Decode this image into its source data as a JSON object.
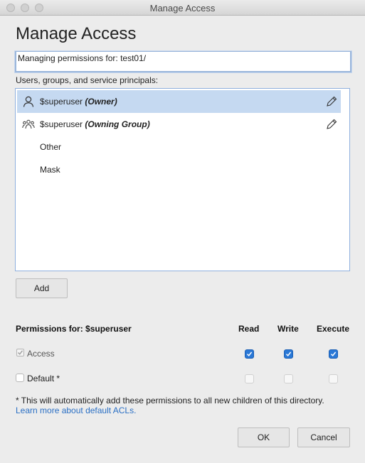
{
  "window": {
    "title": "Manage Access"
  },
  "dialog": {
    "heading": "Manage Access",
    "managing_path": "Managing permissions for: test01/",
    "principals_label": "Users, groups, and service principals:",
    "principals": [
      {
        "name": "$superuser",
        "role": "(Owner)",
        "icon": "user-icon",
        "selected": true
      },
      {
        "name": "$superuser",
        "role": "(Owning Group)",
        "icon": "group-icon",
        "selected": false
      },
      {
        "name": "Other",
        "role": "",
        "icon": "",
        "selected": false
      },
      {
        "name": "Mask",
        "role": "",
        "icon": "",
        "selected": false
      }
    ],
    "add_label": "Add",
    "permissions": {
      "title": "Permissions for: $superuser",
      "columns": [
        "Read",
        "Write",
        "Execute"
      ],
      "rows": [
        {
          "label": "Access",
          "read": true,
          "write": true,
          "execute": true
        },
        {
          "label": "Default *",
          "read": false,
          "write": false,
          "execute": false
        }
      ]
    },
    "footnote_text": "* This will automatically add these permissions to all new children of this directory. ",
    "footnote_link": "Learn more about default ACLs.",
    "ok_label": "OK",
    "cancel_label": "Cancel"
  },
  "colors": {
    "accent": "#2a78d6",
    "selection": "#c5d9f1",
    "link": "#2a6fc4"
  }
}
